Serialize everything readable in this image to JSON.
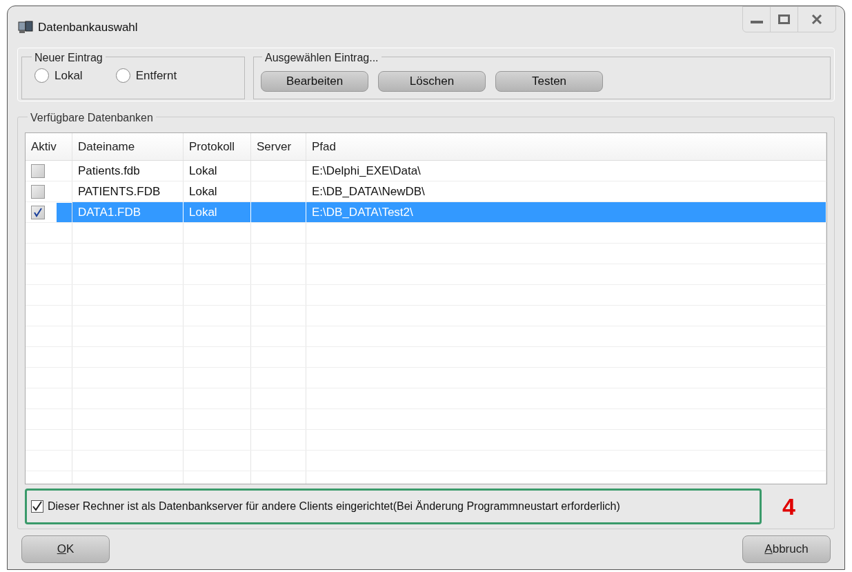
{
  "window": {
    "title": "Datenbankauswahl"
  },
  "new_entry": {
    "title": "Neuer Eintrag",
    "options": [
      {
        "label": "Lokal",
        "selected": false
      },
      {
        "label": "Entfernt",
        "selected": false
      }
    ]
  },
  "selected_entry": {
    "title": "Ausgewählen Eintrag...",
    "buttons": [
      "Bearbeiten",
      "Löschen",
      "Testen"
    ]
  },
  "databases": {
    "title": "Verfügbare Datenbanken",
    "columns": [
      "Aktiv",
      "Dateiname",
      "Protokoll",
      "Server",
      "Pfad"
    ],
    "rows": [
      {
        "checked": false,
        "selected": false,
        "file": "Patients.fdb",
        "protocol": "Lokal",
        "server": "",
        "path": "E:\\Delphi_EXE\\Data\\"
      },
      {
        "checked": false,
        "selected": false,
        "file": "PATIENTS.FDB",
        "protocol": "Lokal",
        "server": "",
        "path": "E:\\DB_DATA\\NewDB\\"
      },
      {
        "checked": true,
        "selected": true,
        "file": "DATA1.FDB",
        "protocol": "Lokal",
        "server": "",
        "path": "E:\\DB_DATA\\Test2\\"
      }
    ]
  },
  "server_option": {
    "label": "Dieser Rechner ist als Datenbankserver für andere Clients eingerichtet(Bei Änderung Programmneustart erforderlich)",
    "checked": true
  },
  "annotation": "4",
  "buttons": {
    "ok": "OK",
    "cancel": "Abbruch"
  }
}
